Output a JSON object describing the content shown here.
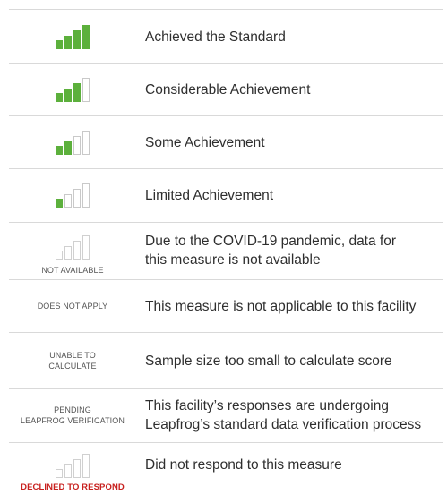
{
  "colors": {
    "bar_filled": "#5cb03c",
    "bar_empty_border": "#c9c9c9",
    "declined_red": "#c8201e",
    "divider": "#d9d9d9"
  },
  "rows": [
    {
      "id": "achieved",
      "bars_filled": 4,
      "status_label": "",
      "description_lines": [
        "Achieved the Standard"
      ]
    },
    {
      "id": "considerable",
      "bars_filled": 3,
      "status_label": "",
      "description_lines": [
        "Considerable Achievement"
      ]
    },
    {
      "id": "some",
      "bars_filled": 2,
      "status_label": "",
      "description_lines": [
        "Some Achievement"
      ]
    },
    {
      "id": "limited",
      "bars_filled": 1,
      "status_label": "",
      "description_lines": [
        "Limited Achievement"
      ]
    },
    {
      "id": "not-available",
      "bars_filled": 0,
      "status_label": "NOT AVAILABLE",
      "description_lines": [
        "Due to the COVID-19 pandemic, data for",
        "this measure is not available"
      ]
    },
    {
      "id": "does-not-apply",
      "bars_filled": null,
      "status_label": "DOES NOT APPLY",
      "description_lines": [
        "This measure is not applicable to this facility"
      ]
    },
    {
      "id": "unable-to-calculate",
      "bars_filled": null,
      "status_label_lines": [
        "UNABLE TO",
        "CALCULATE"
      ],
      "description_lines": [
        "Sample size too small to calculate score"
      ]
    },
    {
      "id": "pending",
      "bars_filled": null,
      "status_label_lines": [
        "PENDING",
        "LEAPFROG VERIFICATION"
      ],
      "description_lines": [
        "This facility’s responses are undergoing",
        "Leapfrog’s standard data verification process"
      ]
    },
    {
      "id": "declined",
      "bars_filled": 0,
      "status_label": "DECLINED TO RESPOND",
      "description_lines": [
        "Did not respond to this measure"
      ]
    }
  ]
}
